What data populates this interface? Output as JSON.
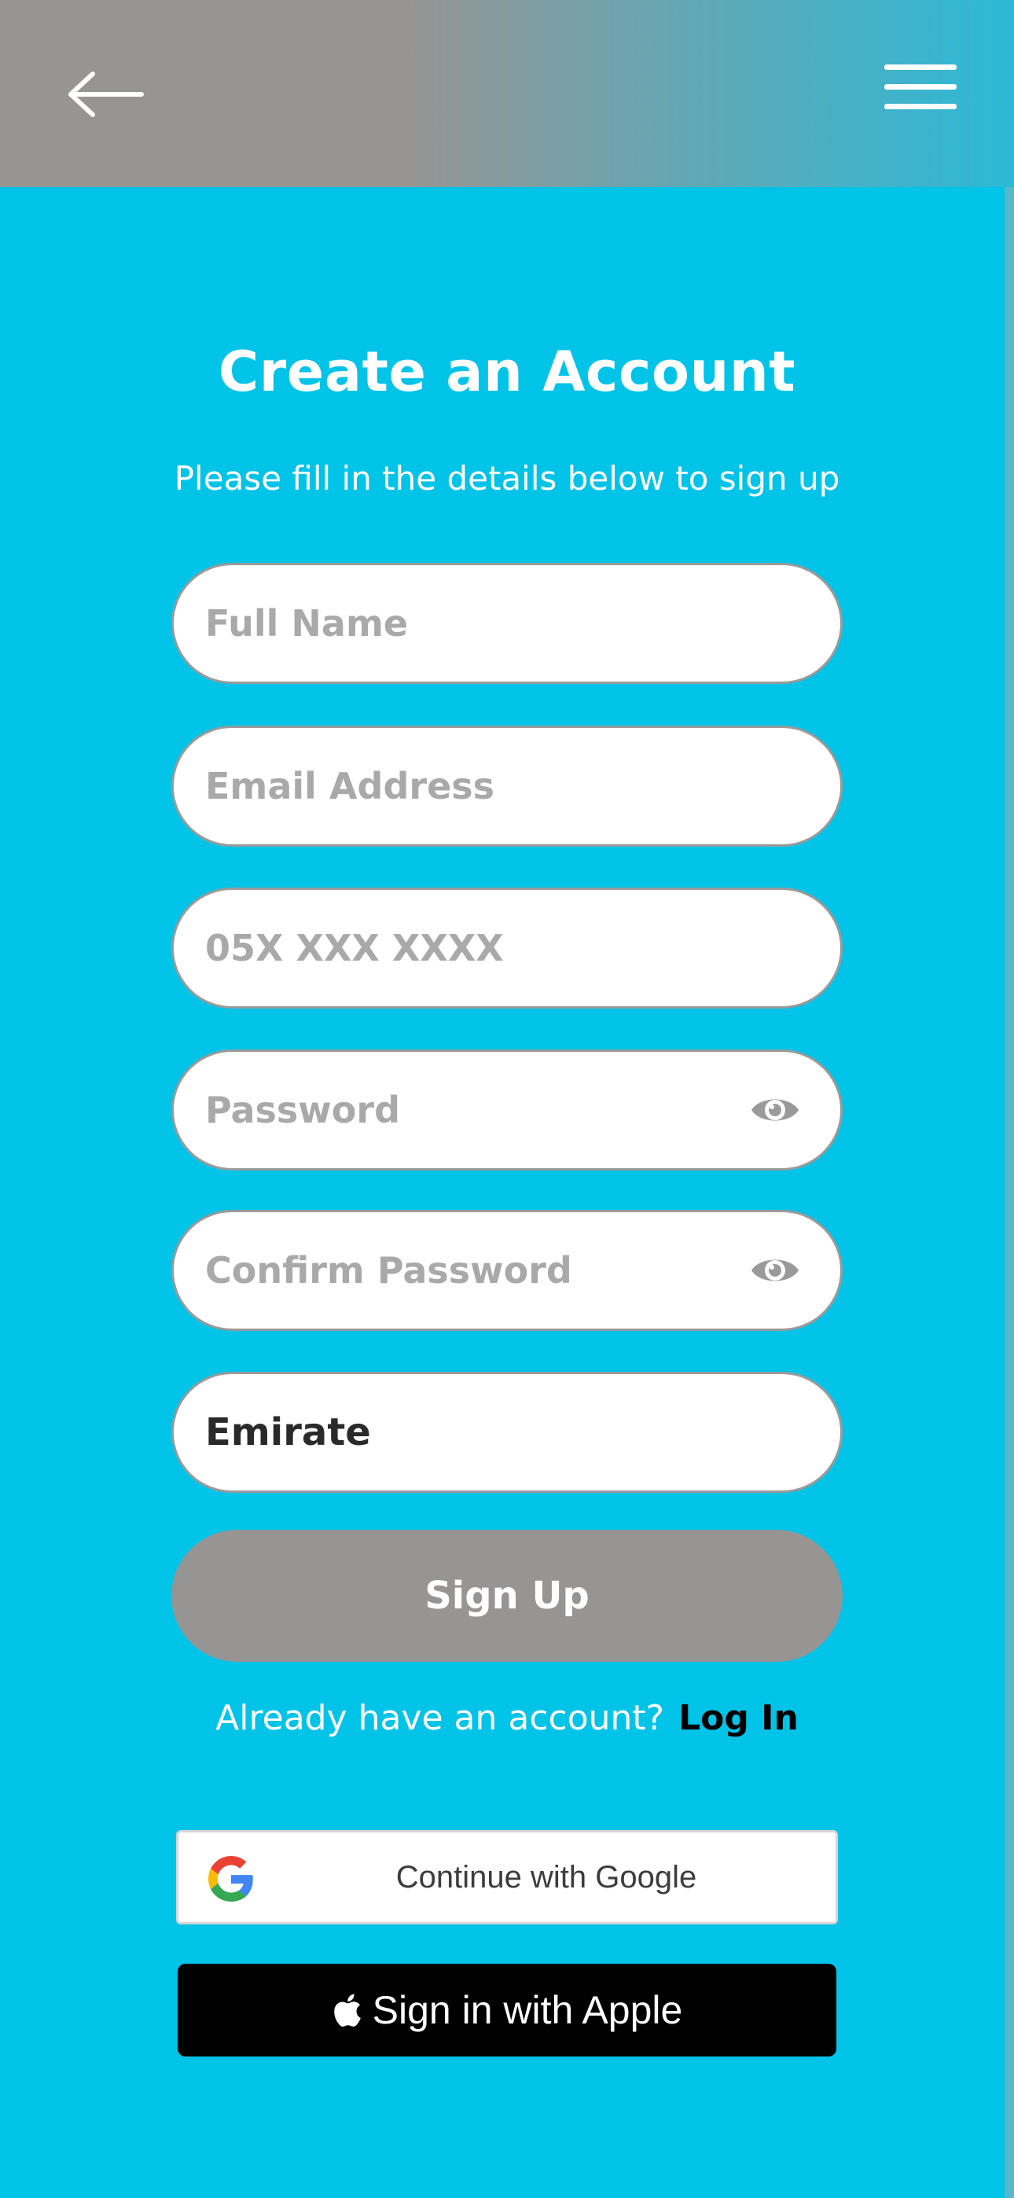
{
  "header": {
    "back_icon": "arrow-left-icon",
    "menu_icon": "hamburger-menu-icon",
    "colors": {
      "gradient_start": "#979593",
      "gradient_end": "#2cb9d6"
    }
  },
  "page": {
    "background": "#00c3e8",
    "title": "Create an Account",
    "subtitle": "Please fill in the details below to sign up"
  },
  "form": {
    "full_name": {
      "placeholder": "Full Name",
      "value": ""
    },
    "email": {
      "placeholder": "Email Address",
      "value": ""
    },
    "phone": {
      "placeholder": "05X XXX XXXX",
      "value": ""
    },
    "password": {
      "placeholder": "Password",
      "value": "",
      "toggle_icon": "eye-icon"
    },
    "confirm_password": {
      "placeholder": "Confirm Password",
      "value": "",
      "toggle_icon": "eye-icon"
    },
    "emirate": {
      "selected": "Emirate"
    },
    "submit_label": "Sign Up",
    "submit_color": "#979593"
  },
  "login_prompt": {
    "question": "Already have an account?",
    "link": "Log In"
  },
  "social": {
    "google": {
      "label": "Continue with Google",
      "icon": "google-logo-icon"
    },
    "apple": {
      "label": "Sign in with Apple",
      "icon": "apple-logo-icon"
    }
  }
}
